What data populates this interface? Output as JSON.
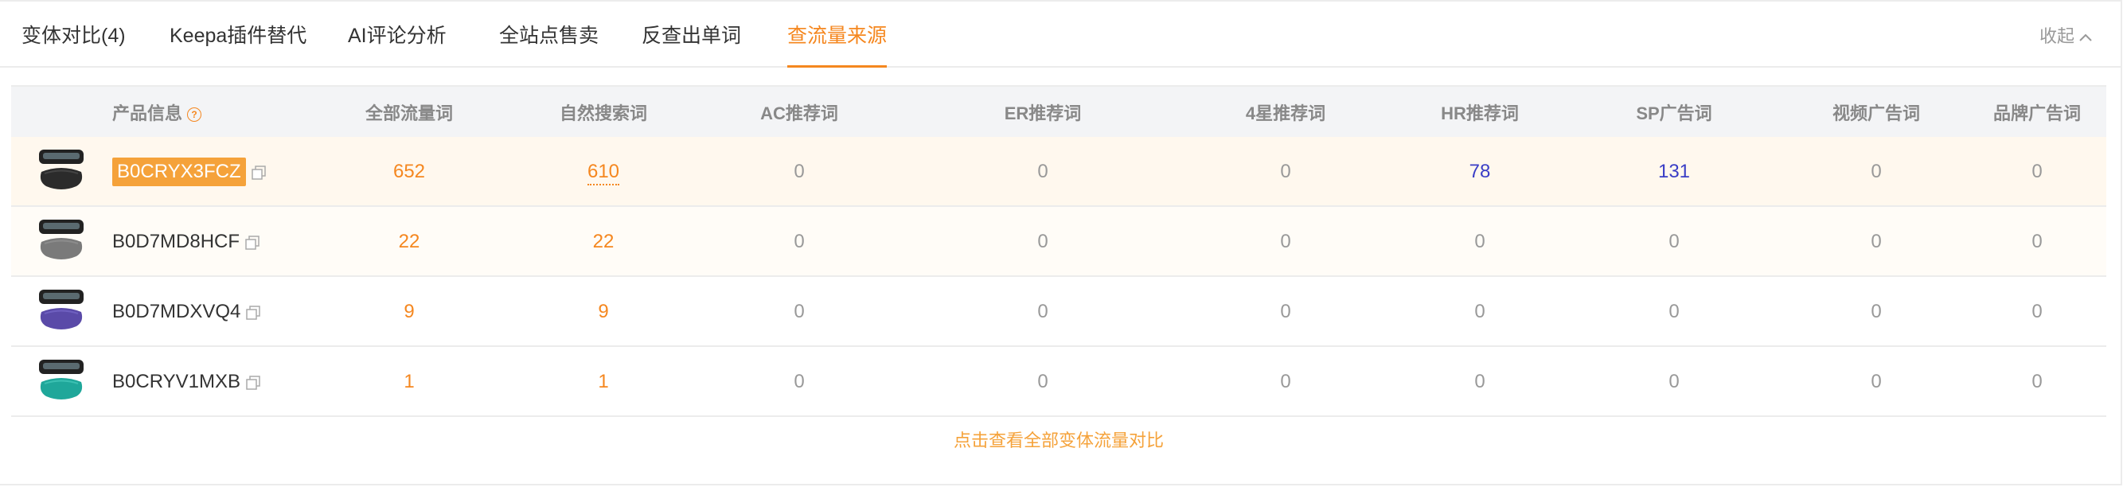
{
  "tabs": [
    {
      "label": "变体对比(4)",
      "active": false
    },
    {
      "label": "Keepa插件替代",
      "active": false
    },
    {
      "label": "AI评论分析",
      "active": false
    },
    {
      "label": "全站点售卖",
      "active": false
    },
    {
      "label": "反查出单词",
      "active": false
    },
    {
      "label": "查流量来源",
      "active": true
    }
  ],
  "collapse_label": "收起",
  "table": {
    "headers": [
      "产品信息",
      "全部流量词",
      "自然搜索词",
      "AC推荐词",
      "ER推荐词",
      "4星推荐词",
      "HR推荐词",
      "SP广告词",
      "视频广告词",
      "品牌广告词"
    ],
    "rows": [
      {
        "asin": "B0CRYX3FCZ",
        "selected": true,
        "thumb_color": "#2b2b2b",
        "values": [
          "652",
          "610",
          "0",
          "0",
          "0",
          "78",
          "131",
          "0",
          "0"
        ]
      },
      {
        "asin": "B0D7MD8HCF",
        "selected": false,
        "thumb_color": "#7a7a7a",
        "values": [
          "22",
          "22",
          "0",
          "0",
          "0",
          "0",
          "0",
          "0",
          "0"
        ]
      },
      {
        "asin": "B0D7MDXVQ4",
        "selected": false,
        "thumb_color": "#5a4aa8",
        "values": [
          "9",
          "9",
          "0",
          "0",
          "0",
          "0",
          "0",
          "0",
          "0"
        ]
      },
      {
        "asin": "B0CRYV1MXB",
        "selected": false,
        "thumb_color": "#1fa79a",
        "values": [
          "1",
          "1",
          "0",
          "0",
          "0",
          "0",
          "0",
          "0",
          "0"
        ]
      }
    ]
  },
  "footer_link": "点击查看全部变体流量对比",
  "colors": {
    "accent": "#f5871f",
    "link_blue": "#3a3ec6",
    "muted": "#999999"
  }
}
